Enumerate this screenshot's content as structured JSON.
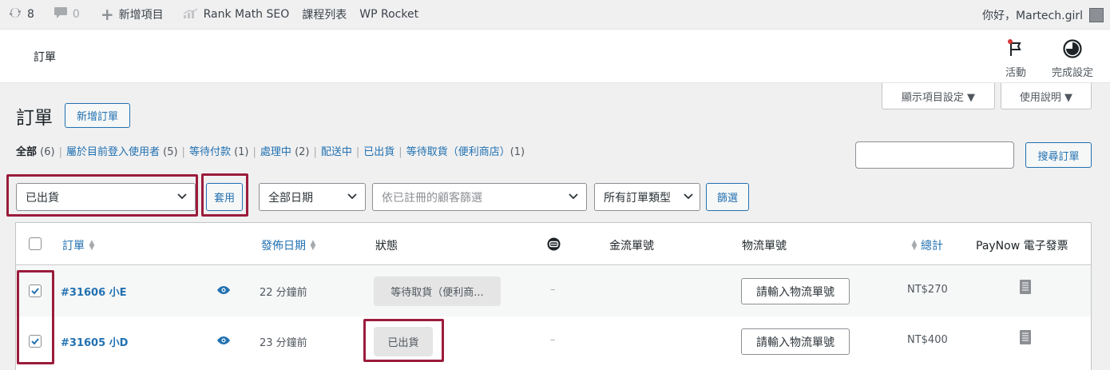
{
  "adminbar": {
    "updates_count": "8",
    "comments_count": "0",
    "new_label": "新增項目",
    "rank_math": "Rank Math SEO",
    "courses": "課程列表",
    "wp_rocket": "WP Rocket",
    "greeting": "你好，Martech.girl"
  },
  "header": {
    "title": "訂單",
    "activity_label": "活動",
    "setup_label": "完成設定"
  },
  "screen_options": {
    "display_label": "顯示項目設定 ▼",
    "help_label": "使用說明 ▼"
  },
  "page": {
    "title": "訂單",
    "add_order": "新增訂單",
    "search_button": "搜尋訂單",
    "search_value": ""
  },
  "views": [
    {
      "label": "全部",
      "count": "(6)",
      "current": true
    },
    {
      "label": "屬於目前登入使用者",
      "count": "(5)"
    },
    {
      "label": "等待付款",
      "count": "(1)"
    },
    {
      "label": "處理中",
      "count": "(2)"
    },
    {
      "label": "配送中",
      "count": ""
    },
    {
      "label": "已出貨",
      "count": ""
    },
    {
      "label": "等待取貨（便利商店）",
      "count": "(1)"
    }
  ],
  "filters": {
    "bulk_action_value": "已出貨",
    "apply": "套用",
    "date_filter": "全部日期",
    "customer_placeholder": "依已註冊的顧客篩選",
    "order_type": "所有訂單類型",
    "filter_button": "篩選"
  },
  "table": {
    "columns": {
      "order": "訂單",
      "date": "發佈日期",
      "status": "狀態",
      "payment_no": "金流單號",
      "tracking": "物流單號",
      "total": "總計",
      "invoice": "PayNow 電子發票"
    },
    "rows": [
      {
        "order": "#31606 小E",
        "date": "22 分鐘前",
        "status": "等待取貨（便利商...",
        "payment": "–",
        "tracking_placeholder": "請輸入物流單號",
        "total": "NT$270",
        "checked": true
      },
      {
        "order": "#31605 小D",
        "date": "23 分鐘前",
        "status": "已出貨",
        "payment": "–",
        "tracking_placeholder": "請輸入物流單號",
        "total": "NT$400",
        "checked": true
      }
    ]
  },
  "colors": {
    "highlight": "#9b1c3b",
    "link": "#2271b1"
  }
}
